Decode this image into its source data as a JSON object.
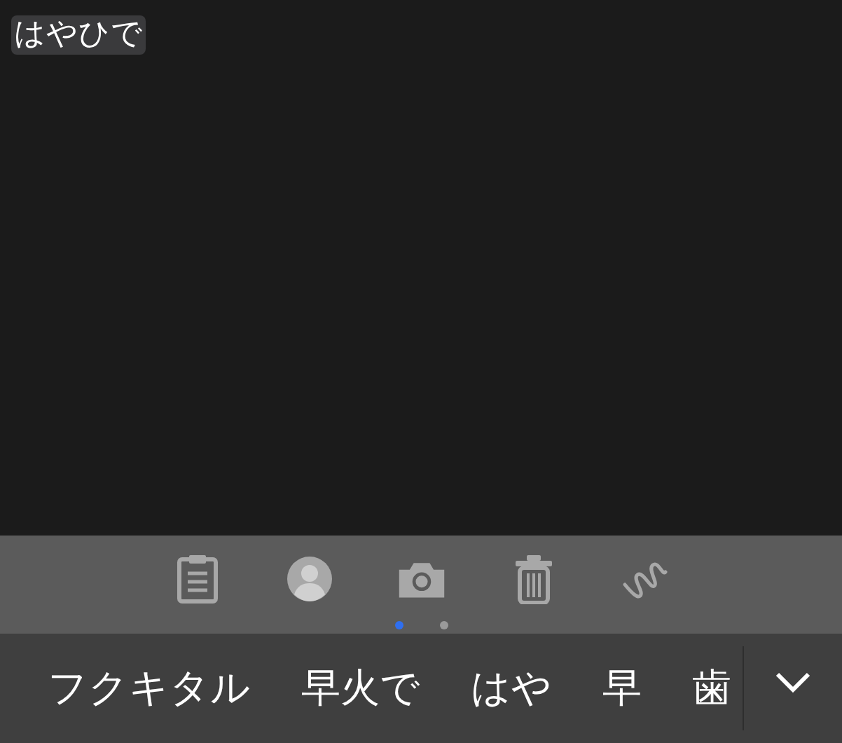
{
  "composing_text": "はやひで",
  "toolbar_pages": [
    {
      "selected": true
    },
    {
      "selected": false
    }
  ],
  "candidates": [
    "フクキタル",
    "早火で",
    "はや",
    "早",
    "歯"
  ]
}
